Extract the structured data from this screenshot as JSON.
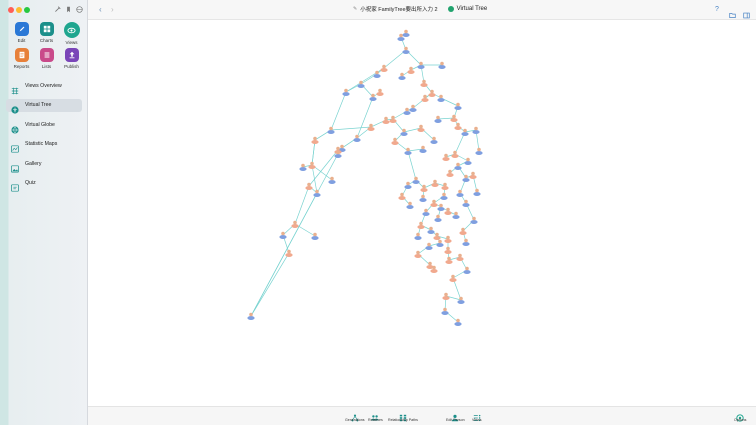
{
  "window": {
    "title": "小祝家 FamilyTree要出所入力 2",
    "view_name": "Virtual Tree"
  },
  "tools": [
    {
      "label": "Edit",
      "icon": "pencil-icon",
      "color": "#2a78d6"
    },
    {
      "label": "Charts",
      "icon": "chart-grid-icon",
      "color": "#1b8f8a"
    },
    {
      "label": "Views",
      "icon": "eye-icon",
      "color": "#1fa68f"
    },
    {
      "label": "Reports",
      "icon": "report-icon",
      "color": "#e7803a"
    },
    {
      "label": "Lists",
      "icon": "list-icon",
      "color": "#c94a8a"
    },
    {
      "label": "Publish",
      "icon": "publish-icon",
      "color": "#7a45b8"
    }
  ],
  "nav": [
    {
      "label": "Views Overview",
      "icon": "grid-icon"
    },
    {
      "label": "Virtual Tree",
      "icon": "tree-icon"
    },
    {
      "label": "Virtual Globe",
      "icon": "globe-icon"
    },
    {
      "label": "Statistic Maps",
      "icon": "map-icon"
    },
    {
      "label": "Gallery",
      "icon": "gallery-icon"
    },
    {
      "label": "Quiz",
      "icon": "quiz-icon"
    }
  ],
  "bottom_bar": [
    {
      "label": "Generations",
      "icon": "generations-icon"
    },
    {
      "label": "Relatives",
      "icon": "relatives-icon"
    },
    {
      "label": "Relationship Paths",
      "icon": "relationship-paths-icon"
    },
    {
      "label": "Edit Person",
      "icon": "edit-person-icon"
    },
    {
      "label": "Views",
      "icon": "views-icon"
    },
    {
      "label": "Options",
      "icon": "options-icon"
    }
  ],
  "colors": {
    "accent": "#1fa68f",
    "edge": "#79d3d0",
    "male": "#7f9fe0",
    "female": "#f1a98e"
  }
}
